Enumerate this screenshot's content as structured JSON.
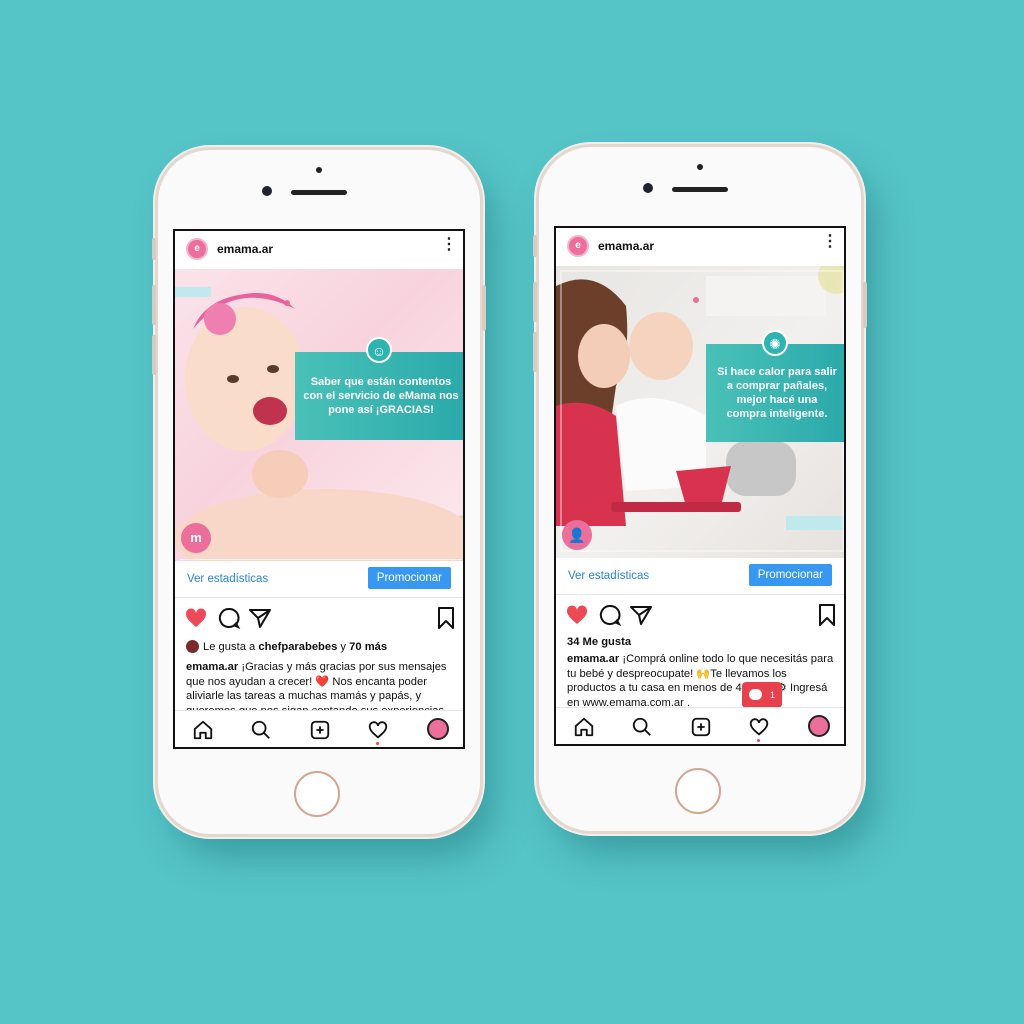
{
  "colors": {
    "background": "#56c5c8",
    "accent_teal": "#2db4b0",
    "brand_pink": "#ec6e9b",
    "link_blue": "#2a84d8",
    "button_blue": "#3897f0",
    "like_red": "#ed4956"
  },
  "posts": [
    {
      "username": "emama.ar",
      "banner_text": "Saber que están contentos con el servicio de eMama nos pone así ¡GRACIAS!",
      "stats_link": "Ver estadísticas",
      "promote_label": "Promocionar",
      "likes_prefix": "Le gusta a ",
      "likes_user": "chefparabebes",
      "likes_and": " y ",
      "likes_more": "70 más",
      "caption_user": "emama.ar",
      "caption_text": " ¡Gracias y más gracias por sus mensajes que nos ayudan a crecer! ❤️ Nos encanta poder aliviarle las tareas a muchas mamás y papás, y queremos que nos sigan contando sus experiencias"
    },
    {
      "username": "emama.ar",
      "banner_text": "Si hace calor para salir a comprar pañales, mejor hacé una compra inteligente.",
      "stats_link": "Ver estadísticas",
      "promote_label": "Promocionar",
      "likes_count": "34 Me gusta",
      "caption_user": "emama.ar",
      "caption_text": " ¡Comprá online todo lo que necesitás para tu bebé y despreocupate! 🙌Te llevamos los productos a tu casa en menos de 48hs 🚚⚙ Ingresá en www.emama.com.ar .",
      "notification_count": "1"
    }
  ],
  "icons": [
    "heart-icon",
    "comment-icon",
    "share-icon",
    "bookmark-icon",
    "home-icon",
    "search-icon",
    "add-post-icon",
    "activity-icon",
    "profile-icon"
  ]
}
